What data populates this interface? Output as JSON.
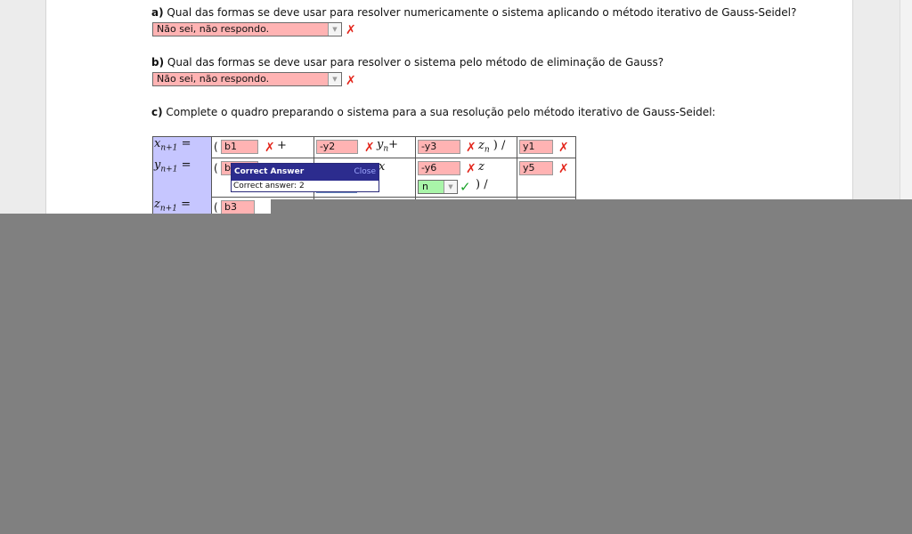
{
  "questions": {
    "a": {
      "letter": "a)",
      "text": " Qual das formas se deve usar para resolver numericamente o sistema aplicando o método iterativo de Gauss-Seidel?",
      "answer": "Não sei, não respondo."
    },
    "b": {
      "letter": "b)",
      "text": " Qual das formas se deve usar para resolver o sistema pelo método de eliminação de Gauss?",
      "answer": "Não sei, não respondo."
    },
    "c": {
      "letter": "c)",
      "text": " Complete o quadro preparando o sistema para a sua resolução pelo método iterativo de Gauss-Seidel:"
    }
  },
  "table": {
    "rows": [
      {
        "var": "x",
        "sub": "n+1",
        "op": "=",
        "inputs": [
          "b1",
          "-y2",
          "-y3",
          "y1"
        ],
        "terms": [
          "+",
          "y",
          "z"
        ]
      },
      {
        "var": "y",
        "sub": "n+1",
        "op": "=",
        "inputs": [
          "b2",
          "-y6",
          "y5"
        ],
        "terms": [
          "x",
          "z"
        ],
        "select": "n"
      },
      {
        "var": "z",
        "sub": "n+1",
        "op": "=",
        "inputs": [
          "b3"
        ]
      }
    ],
    "term_y": "y",
    "term_y_sub": "n",
    "plus": "+",
    "term_z": "z",
    "term_z_sub": "n",
    "close_div": ") /",
    "open": "(",
    "term_x": "x",
    "term_z2": "z"
  },
  "popup": {
    "title": "Correct Answer",
    "close": "Close",
    "body": "Correct answer:  2"
  },
  "icons": {
    "wrong": "cross-mark-icon",
    "right": "check-mark-icon",
    "dropdown": "chevron-down-icon"
  },
  "colors": {
    "wrong_bg": "#ffb3b3",
    "right_bg": "#a9f5a9",
    "header_bg": "#c6c6ff",
    "popup_title": "#2c2c8e",
    "overlay": "#808080"
  }
}
